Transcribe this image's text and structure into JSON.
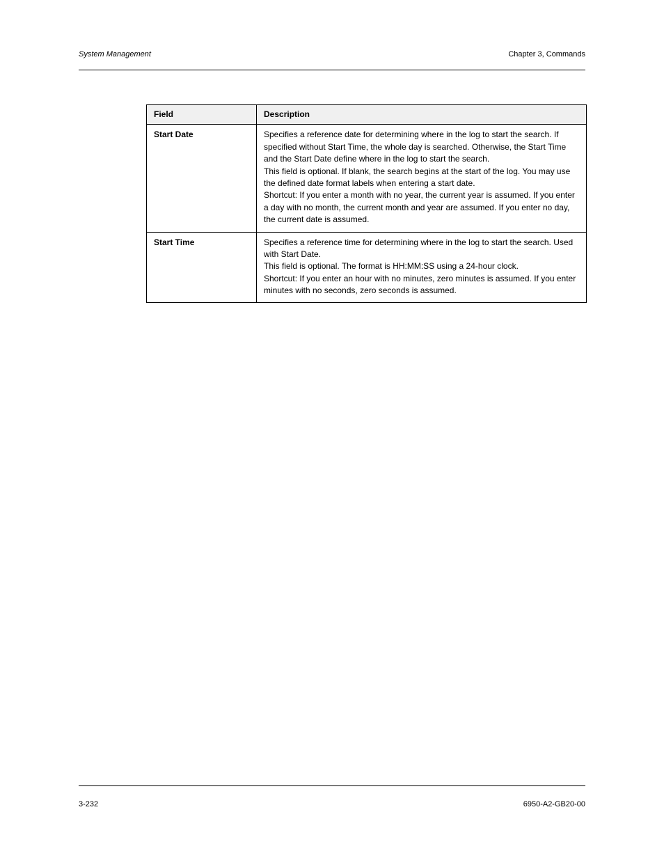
{
  "header": {
    "topic": "System Management",
    "chapter": "Chapter 3, Commands"
  },
  "table": {
    "cols": [
      "Field",
      "Description"
    ],
    "rows": [
      {
        "field": "Start Date",
        "desc": "Specifies a reference date for determining where in the log to start the search. If specified without Start Time, the whole day is searched. Otherwise, the Start Time and the Start Date define where in the log to start the search.\nThis field is optional. If blank, the search begins at the start of the log. You may use the defined date format labels when entering a start date.\nShortcut: If you enter a month with no year, the current year is assumed. If you enter a day with no month, the current month and year are assumed. If you enter no day, the current date is assumed."
      },
      {
        "field": "Start Time",
        "desc": "Specifies a reference time for determining where in the log to start the search. Used with Start Date.\nThis field is optional. The format is HH:MM:SS using a 24-hour clock.\nShortcut: If you enter an hour with no minutes, zero minutes is assumed. If you enter minutes with no seconds, zero seconds is assumed."
      }
    ]
  },
  "footer": {
    "left": "3-232",
    "right": "6950-A2-GB20-00"
  }
}
